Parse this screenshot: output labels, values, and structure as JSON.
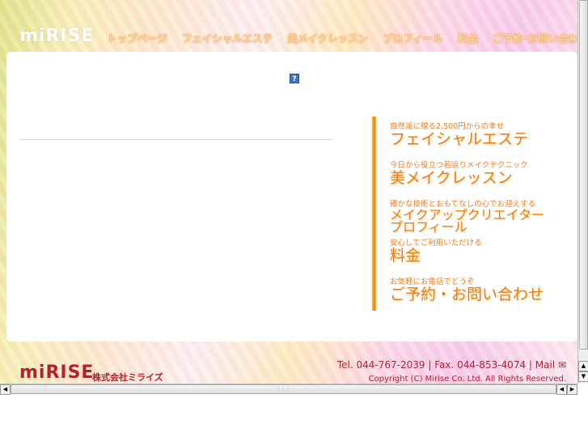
{
  "header": {
    "logo": "miRISE",
    "nav": [
      "トップページ",
      "フェイシャルエステ",
      "美メイクレッスン",
      "プロフィール",
      "料金",
      "ご予約･お問い合わせ"
    ]
  },
  "main": {
    "help_icon": "?",
    "menu": [
      {
        "sub": "自然派に贈る2,500円からの幸せ",
        "main": "フェイシャルエステ"
      },
      {
        "sub": "今日から役立つ若返りメイクテクニック",
        "main": "美メイクレッスン"
      },
      {
        "sub": "確かな技術とおもてなしの心でお迎えする",
        "main": "メイクアップクリエイター",
        "main2": "プロフィール"
      },
      {
        "sub": "安心してご利用いただける",
        "main": "料金"
      },
      {
        "sub": "お気軽にお電話でどうぞ",
        "main": "ご予約・お問い合わせ"
      }
    ]
  },
  "footer": {
    "logo": "miRISE",
    "company": "株式会社ミライズ",
    "contact": "Tel.  044-767-2039 | Fax.  044-853-4074 | Mail ✉",
    "copyright": "Copyright (C) Mirise Co. Ltd. All Rights Reserved."
  }
}
